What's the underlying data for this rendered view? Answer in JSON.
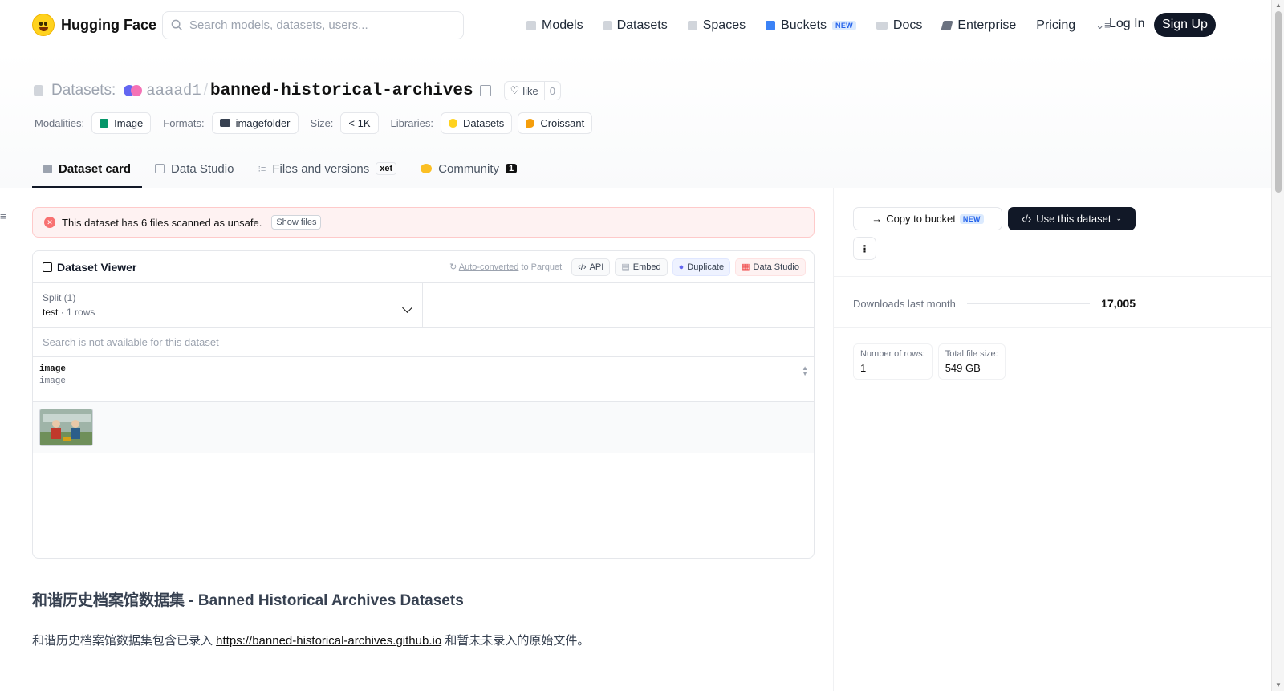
{
  "nav": {
    "brand": "Hugging Face",
    "search_placeholder": "Search models, datasets, users...",
    "links": {
      "models": "Models",
      "datasets": "Datasets",
      "spaces": "Spaces",
      "buckets": "Buckets",
      "buckets_badge": "NEW",
      "docs": "Docs",
      "enterprise": "Enterprise",
      "pricing": "Pricing"
    },
    "login": "Log In",
    "signup": "Sign Up"
  },
  "header": {
    "section": "Datasets:",
    "owner": "aaaad1",
    "separator": "/",
    "repo": "banned-historical-archives",
    "like_label": "like",
    "like_count": "0",
    "meta": {
      "modalities_label": "Modalities:",
      "modality": "Image",
      "formats_label": "Formats:",
      "format": "imagefolder",
      "size_label": "Size:",
      "size": "< 1K",
      "libraries_label": "Libraries:",
      "library_1": "Datasets",
      "library_2": "Croissant"
    },
    "tabs": {
      "card": "Dataset card",
      "studio": "Data Studio",
      "files": "Files and versions",
      "files_badge": "xet",
      "community": "Community",
      "community_count": "1"
    }
  },
  "alert": {
    "text": "This dataset has 6 files scanned as unsafe.",
    "button": "Show files"
  },
  "viewer": {
    "title": "Dataset Viewer",
    "auto_converted": "Auto-converted",
    "to_parquet": "to Parquet",
    "btn_api": "API",
    "btn_embed": "Embed",
    "btn_duplicate": "Duplicate",
    "btn_studio": "Data Studio",
    "split_label": "Split (1)",
    "split_name": "test",
    "split_dot": "·",
    "split_rows": "1 rows",
    "search_disabled": "Search is not available for this dataset",
    "column_name": "image",
    "column_type": "image"
  },
  "content": {
    "heading_cn": "和谐历史档案馆数据集",
    "heading_en": " - Banned Historical Archives Datasets",
    "para_before": "和谐历史档案馆数据集包含已录入 ",
    "para_link": "https://banned-historical-archives.github.io",
    "para_after": " 和暂未未录入的原始文件。"
  },
  "sidebar": {
    "copy_bucket": "Copy to bucket",
    "copy_badge": "NEW",
    "use_dataset": "Use this dataset",
    "downloads_label": "Downloads last month",
    "downloads_value": "17,005",
    "rows_label": "Number of rows:",
    "rows_value": "1",
    "size_label": "Total file size:",
    "size_value": "549 GB"
  },
  "colors": {
    "primary_dark": "#111827",
    "alert_bg": "#fef2f2",
    "brand_yellow": "#ffd21e"
  }
}
